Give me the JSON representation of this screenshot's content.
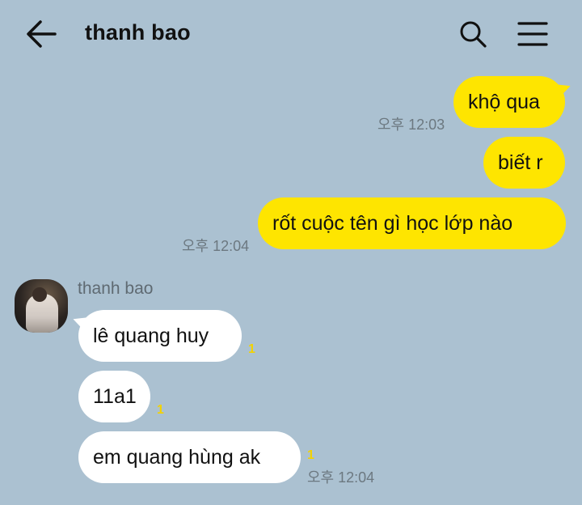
{
  "header": {
    "title": "thanh bao",
    "back_icon": "back-arrow-icon",
    "search_icon": "search-icon",
    "menu_icon": "hamburger-menu-icon"
  },
  "colors": {
    "background": "#abc1d1",
    "outgoing_bubble": "#fee500",
    "incoming_bubble": "#ffffff",
    "unread_count": "#f3d200"
  },
  "chat": {
    "outgoing": [
      {
        "text": "khộ qua",
        "time": "오후 12:03"
      },
      {
        "text": "biết r",
        "time": ""
      },
      {
        "text": "rốt cuộc tên gì học lớp nào",
        "time": "오후 12:04"
      }
    ],
    "incoming_sender": "thanh bao",
    "incoming": [
      {
        "text": "lê quang huy",
        "unread": "1",
        "time": ""
      },
      {
        "text": "11a1",
        "unread": "1",
        "time": ""
      },
      {
        "text": "em quang hùng ak",
        "unread": "1",
        "time": "오후 12:04"
      }
    ]
  }
}
